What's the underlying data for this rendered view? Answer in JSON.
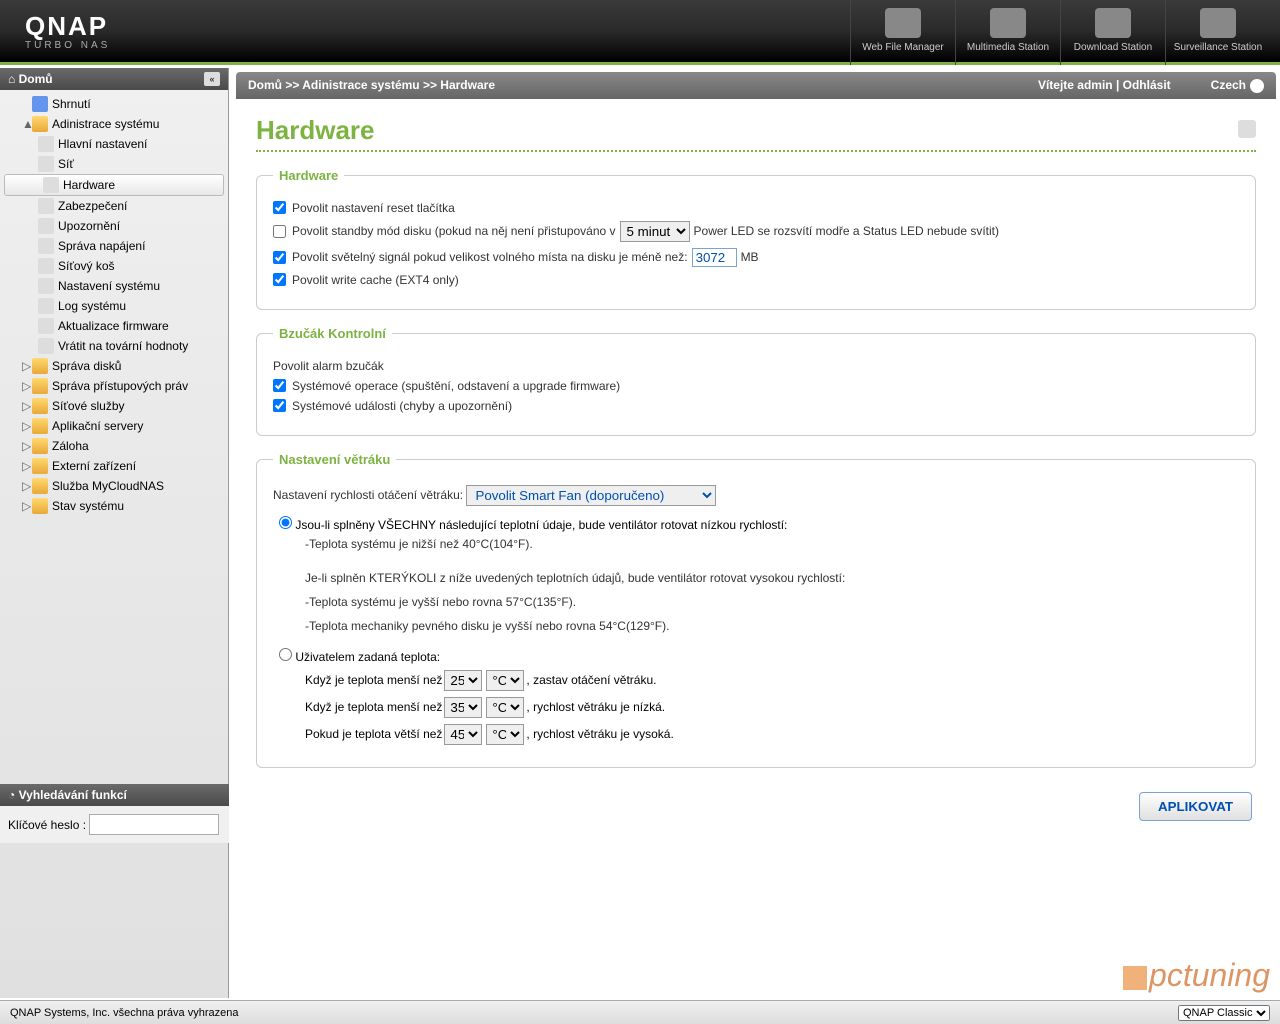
{
  "header": {
    "brand": "QNAP",
    "subbrand": "TURBO NAS",
    "apps": [
      {
        "label": "Web File Manager"
      },
      {
        "label": "Multimedia Station"
      },
      {
        "label": "Download Station"
      },
      {
        "label": "Surveillance Station"
      }
    ]
  },
  "sidebar": {
    "title": "Domů",
    "items": [
      {
        "label": "Shrnutí",
        "level": 1,
        "icon": "home-i"
      },
      {
        "label": "Adinistrace systému",
        "level": 1,
        "icon": "folder",
        "expander": "▲"
      },
      {
        "label": "Hlavní nastavení",
        "level": 2
      },
      {
        "label": "Síť",
        "level": 2
      },
      {
        "label": "Hardware",
        "level": 2,
        "selected": true
      },
      {
        "label": "Zabezpečení",
        "level": 2
      },
      {
        "label": "Upozornění",
        "level": 2
      },
      {
        "label": "Správa napájení",
        "level": 2
      },
      {
        "label": "Síťový koš",
        "level": 2
      },
      {
        "label": "Nastavení systému",
        "level": 2
      },
      {
        "label": "Log systému",
        "level": 2
      },
      {
        "label": "Aktualizace firmware",
        "level": 2
      },
      {
        "label": "Vrátit na tovární hodnoty",
        "level": 2
      },
      {
        "label": "Správa disků",
        "level": 1,
        "icon": "folder",
        "expander": "▷"
      },
      {
        "label": "Správa přístupových práv",
        "level": 1,
        "icon": "folder",
        "expander": "▷"
      },
      {
        "label": "Síťové služby",
        "level": 1,
        "icon": "folder",
        "expander": "▷"
      },
      {
        "label": "Aplikační servery",
        "level": 1,
        "icon": "folder",
        "expander": "▷"
      },
      {
        "label": "Záloha",
        "level": 1,
        "icon": "folder",
        "expander": "▷"
      },
      {
        "label": "Externí zařízení",
        "level": 1,
        "icon": "folder",
        "expander": "▷"
      },
      {
        "label": "Služba MyCloudNAS",
        "level": 1,
        "icon": "folder",
        "expander": "▷"
      },
      {
        "label": "Stav systému",
        "level": 1,
        "icon": "folder",
        "expander": "▷"
      }
    ],
    "search_title": "Vyhledávání funkcí",
    "search_label": "Klíčové heslo :"
  },
  "breadcrumb": {
    "path": "Domů >> Adinistrace systému >> Hardware",
    "welcome": "Vítejte admin | Odhlásit",
    "lang": "Czech"
  },
  "page": {
    "title": "Hardware",
    "hw_legend": "Hardware",
    "hw_reset": "Povolit nastavení reset tlačítka",
    "hw_standby_pre": "Povolit standby mód disku (pokud na něj není přistupováno v",
    "hw_standby_val": "5 minut",
    "hw_standby_post": "Power LED se rozsvítí modře a Status LED nebude svítit)",
    "hw_light_pre": "Povolit světelný signál pokud velikost volného místa na disku je méně než:",
    "hw_light_val": "3072",
    "hw_light_unit": "MB",
    "hw_writecache": "Povolit write cache (EXT4 only)",
    "buzzer_legend": "Bzučák Kontrolní",
    "buzzer_enable": "Povolit alarm bzučák",
    "buzzer_ops": "Systémové operace (spuštění, odstavení a upgrade firmware)",
    "buzzer_events": "Systémové události (chyby a upozornění)",
    "fan_legend": "Nastavení větráku",
    "fan_speed_label": "Nastavení rychlosti otáčení větráku:",
    "fan_speed_val": "Povolit Smart Fan (doporučeno)",
    "fan_opt1_head": "Jsou-li splněny VŠECHNY následující teplotní údaje, bude ventilátor rotovat nízkou rychlostí:",
    "fan_opt1_line1": "-Teplota systému je nižší než 40°C(104°F).",
    "fan_opt1_mid": "Je-li splněn KTERÝKOLI z níže uvedených teplotních údajů, bude ventilátor rotovat vysokou rychlostí:",
    "fan_opt1_line2": "-Teplota systému je vyšší nebo rovna 57°C(135°F).",
    "fan_opt1_line3": "-Teplota mechaniky pevného disku je vyšší nebo rovna 54°C(129°F).",
    "fan_opt2_head": "Uživatelem zadaná teplota:",
    "fan_t1_pre": "Když je teplota menší než",
    "fan_t1_val": "25",
    "fan_t1_unit": "°C",
    "fan_t1_post": ", zastav otáčení větráku.",
    "fan_t2_pre": "Když je teplota menší než",
    "fan_t2_val": "35",
    "fan_t2_unit": "°C",
    "fan_t2_post": ", rychlost větráku je nízká.",
    "fan_t3_pre": "Pokud je teplota větší než",
    "fan_t3_val": "45",
    "fan_t3_unit": "°C",
    "fan_t3_post": ", rychlost větráku je vysoká.",
    "apply": "APLIKOVAT"
  },
  "footer": {
    "copyright": "QNAP Systems, Inc. všechna práva vyhrazena",
    "theme": "QNAP Classic"
  },
  "watermark": "pctuning"
}
